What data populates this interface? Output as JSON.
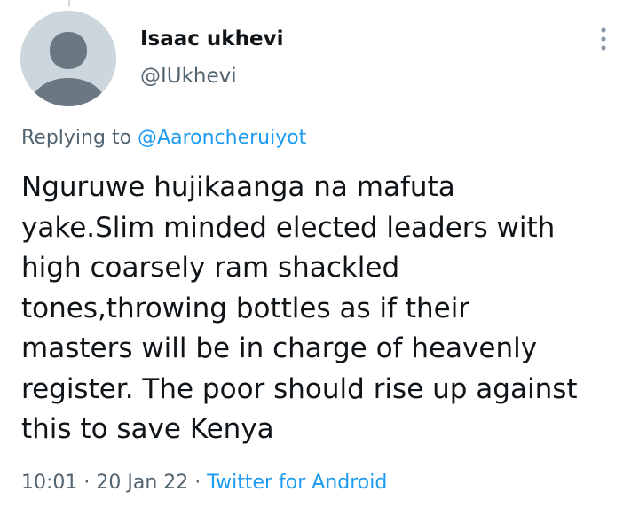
{
  "tweet": {
    "author": {
      "display_name": "Isaac ukhevi",
      "handle": "@IUkhevi",
      "avatar_icon": "default-profile-icon"
    },
    "reply_context": {
      "prefix": "Replying to",
      "mention": "@Aaroncheruiyot"
    },
    "text_lines": [
      "Nguruwe hujikaanga na mafuta",
      "yake.Slim minded elected leaders with",
      "high coarsely ram shackled",
      "tones,throwing bottles as if their",
      "masters will be in charge of heavenly",
      "register. The poor should rise up against",
      "this to save Kenya"
    ],
    "time": "10:01",
    "separator": "·",
    "date": "20 Jan 22",
    "source": "Twitter for Android",
    "more_icon": "more-vertical-icon"
  },
  "colors": {
    "primary_text": "#0f1419",
    "secondary_text": "#536471",
    "link": "#1d9bf0",
    "avatar_bg": "#ccd6dd",
    "avatar_figure": "#6b7783",
    "divider": "#cfd9de"
  }
}
